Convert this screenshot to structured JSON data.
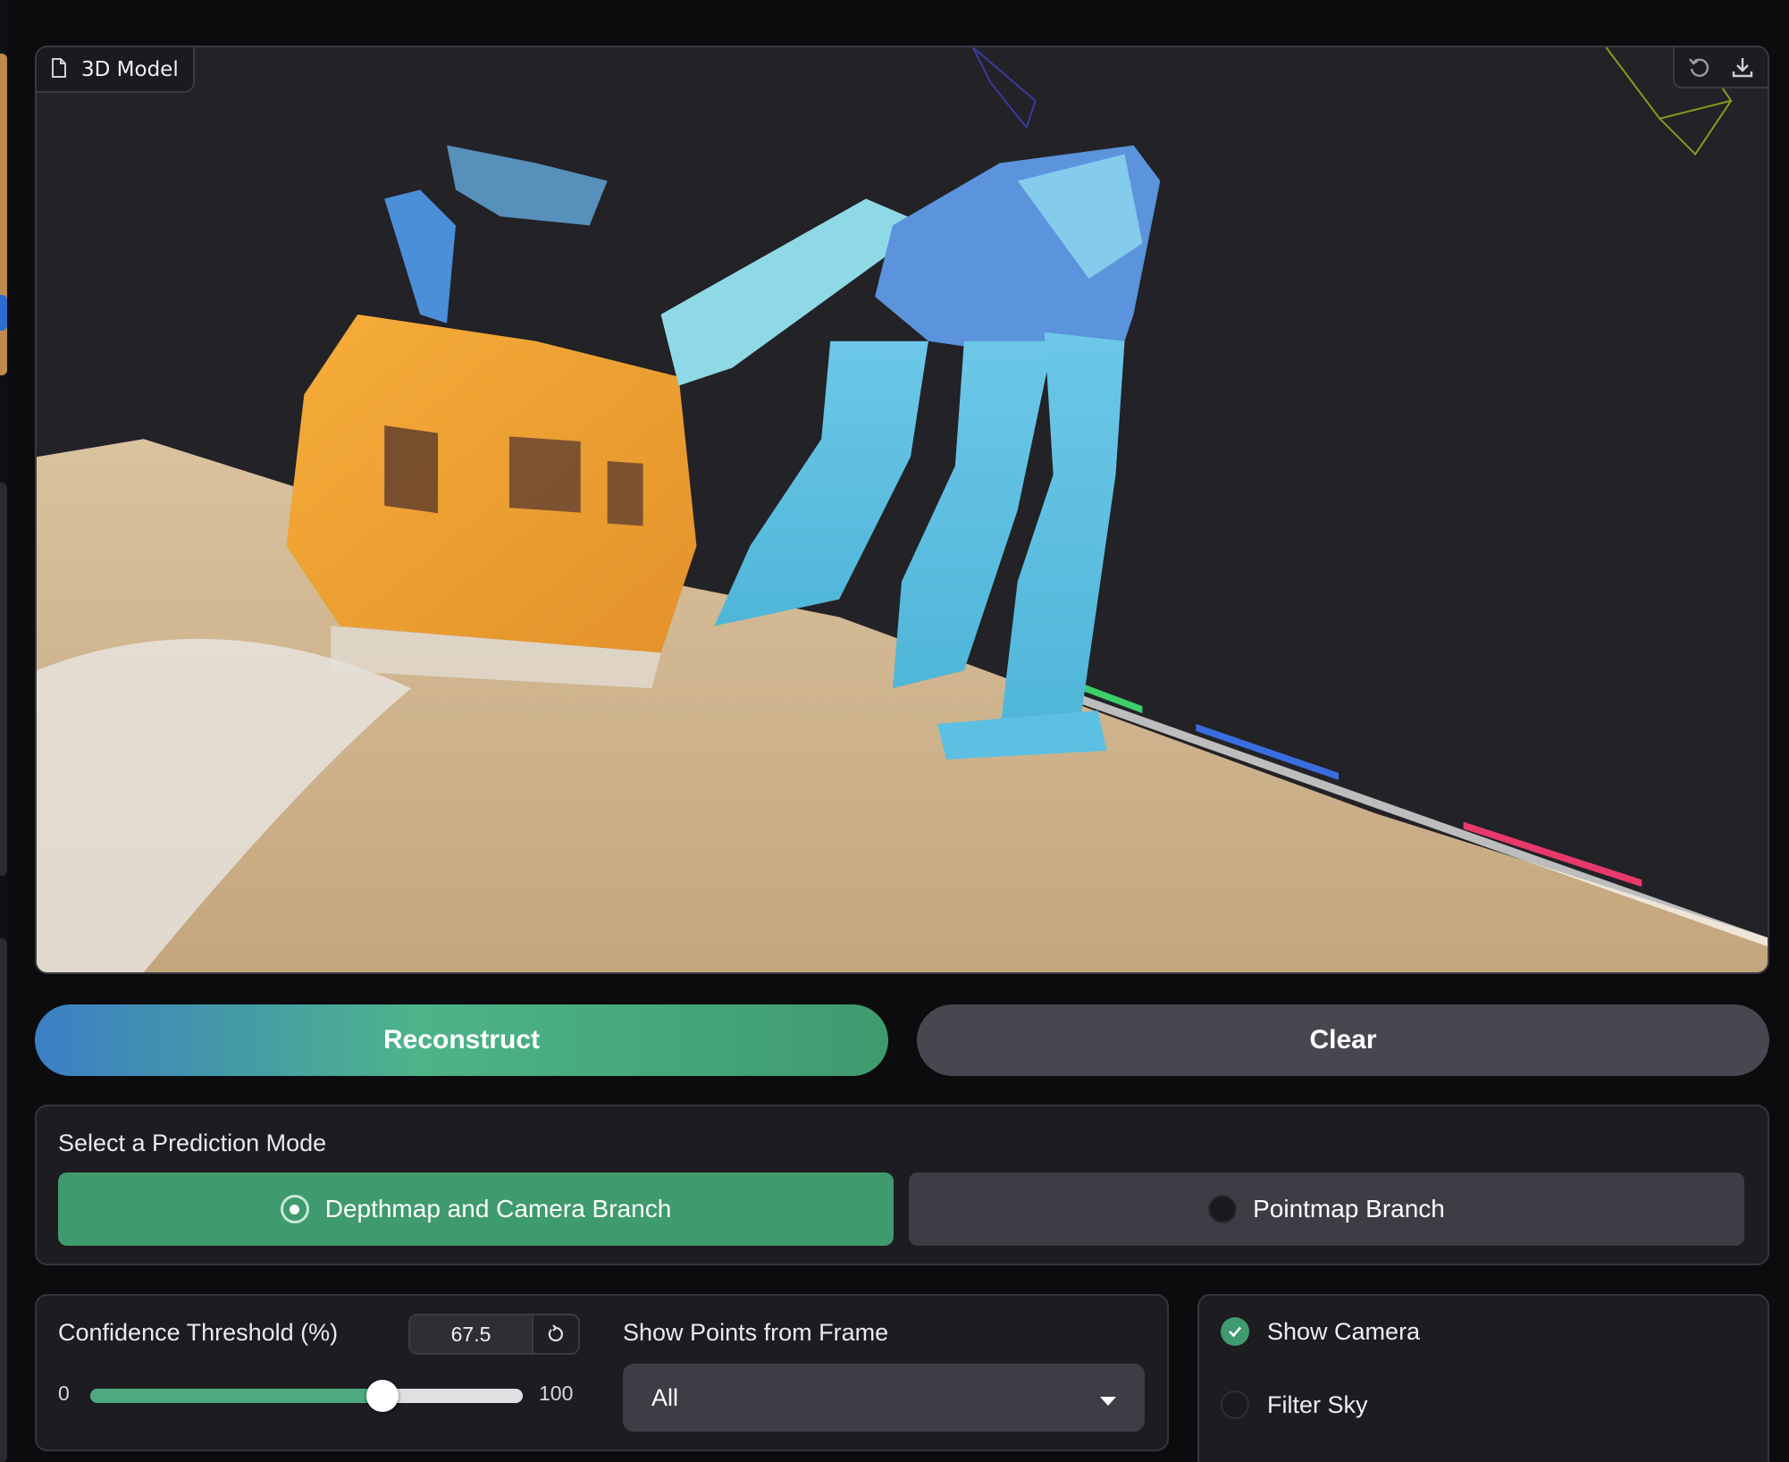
{
  "viewer": {
    "label": "3D Model",
    "icon": "file-icon",
    "tools": [
      "undo-icon",
      "download-icon"
    ]
  },
  "actions": {
    "reconstruct_label": "Reconstruct",
    "clear_label": "Clear"
  },
  "prediction_mode": {
    "title": "Select a Prediction Mode",
    "options": [
      {
        "label": "Depthmap and Camera Branch",
        "selected": true
      },
      {
        "label": "Pointmap Branch",
        "selected": false
      }
    ]
  },
  "confidence": {
    "label": "Confidence Threshold (%)",
    "value": "67.5",
    "min": "0",
    "max": "100",
    "fraction": 0.675
  },
  "frame_filter": {
    "label": "Show Points from Frame",
    "selected": "All"
  },
  "toggles": {
    "show_camera": {
      "label": "Show Camera",
      "checked": true
    },
    "filter_sky": {
      "label": "Filter Sky",
      "checked": false
    }
  },
  "colors": {
    "accent_green": "#3f9a6e",
    "accent_blue": "#3b7fc5",
    "panel_bg": "#1c1c21"
  }
}
